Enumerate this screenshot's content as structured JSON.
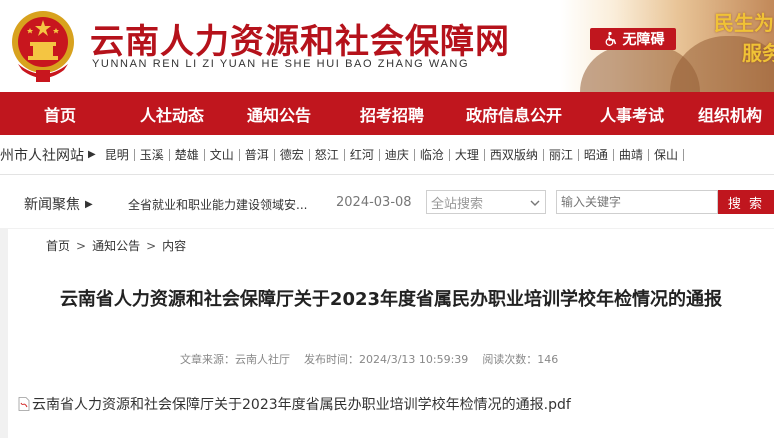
{
  "header": {
    "site_title": "云南人力资源和社会保障网",
    "site_pinyin": "YUNNAN REN LI ZI YUAN HE SHE HUI BAO ZHANG WANG",
    "accessibility_label": "无障碍",
    "slogan_line1": "民生为",
    "slogan_line2": "服务",
    "brand_color": "#c0161e",
    "slogan_color": "#f0c236"
  },
  "nav": {
    "items": [
      {
        "label": "首页"
      },
      {
        "label": "人社动态"
      },
      {
        "label": "通知公告"
      },
      {
        "label": "招考招聘"
      },
      {
        "label": "政府信息公开"
      },
      {
        "label": "人事考试"
      },
      {
        "label": "组织机构"
      }
    ]
  },
  "cities": {
    "label": "州市人社网站",
    "items": [
      "昆明",
      "玉溪",
      "楚雄",
      "文山",
      "普洱",
      "德宏",
      "怒江",
      "红河",
      "迪庆",
      "临沧",
      "大理",
      "西双版纳",
      "丽江",
      "昭通",
      "曲靖",
      "保山"
    ]
  },
  "news": {
    "label": "新闻聚焦",
    "headline": "全省就业和职业能力建设领域安...",
    "date": "2024-03-08"
  },
  "search": {
    "site_search_placeholder": "全站搜索",
    "keyword_placeholder": "输入关键字",
    "button_label": "搜 索"
  },
  "breadcrumb": {
    "home": "首页",
    "section": "通知公告",
    "current": "内容",
    "separator": ">"
  },
  "article": {
    "title": "云南省人力资源和社会保障厅关于2023年度省属民办职业培训学校年检情况的通报",
    "source": "文章来源：云南人社厅",
    "published": "发布时间：2024/3/13 10:59:39",
    "views": "阅读次数：146",
    "attachment": "云南省人力资源和社会保障厅关于2023年度省属民办职业培训学校年检情况的通报.pdf"
  },
  "icons": {
    "emblem": "national-emblem-icon",
    "accessibility": "wheelchair-icon",
    "nav_arrow": "triangle-right-icon",
    "dropdown": "chevron-down-icon",
    "attachment": "pdf-file-icon"
  }
}
